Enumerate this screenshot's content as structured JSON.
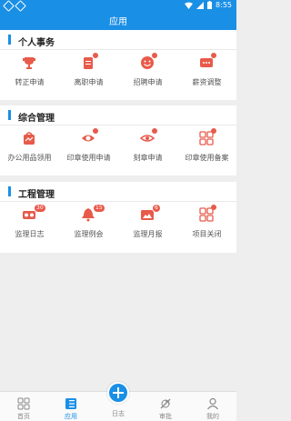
{
  "status": {
    "time": "8:55"
  },
  "header": {
    "title": "应用"
  },
  "sections": [
    {
      "title": "个人事务",
      "items": [
        {
          "label": "转正申请",
          "icon": "trophy-icon"
        },
        {
          "label": "离职申请",
          "icon": "leave-doc-icon"
        },
        {
          "label": "招聘申请",
          "icon": "smile-icon"
        },
        {
          "label": "薪资调整",
          "icon": "salary-chat-icon"
        }
      ]
    },
    {
      "title": "综合管理",
      "items": [
        {
          "label": "办公用品领用",
          "icon": "office-bag-icon"
        },
        {
          "label": "印章使用申请",
          "icon": "seal-eye-icon"
        },
        {
          "label": "刻章申请",
          "icon": "eye-icon"
        },
        {
          "label": "印章使用备案",
          "icon": "grid-icon"
        }
      ]
    },
    {
      "title": "工程管理",
      "items": [
        {
          "label": "监理日志",
          "icon": "vr-glasses-icon",
          "badge": "30"
        },
        {
          "label": "监理例会",
          "icon": "bell-icon",
          "badge": "15"
        },
        {
          "label": "监理月报",
          "icon": "image-icon",
          "badge": "6"
        },
        {
          "label": "项目关闭",
          "icon": "grid-icon"
        }
      ]
    }
  ],
  "bottom_nav": {
    "home": "首页",
    "apps": "应用",
    "log": "日志",
    "approve": "审批",
    "mine": "我的"
  },
  "colors": {
    "primary": "#1a8fe6",
    "accent": "#e85a4a"
  }
}
